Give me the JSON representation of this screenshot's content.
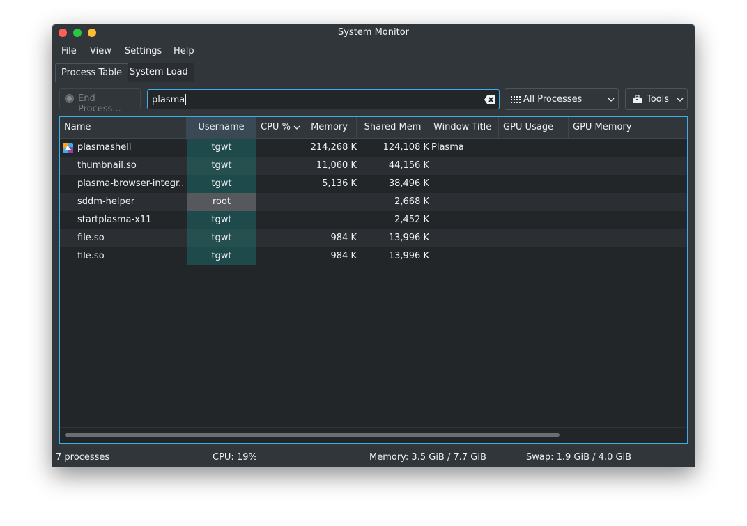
{
  "window": {
    "title": "System Monitor"
  },
  "menu": [
    "File",
    "View",
    "Settings",
    "Help"
  ],
  "tabs": [
    {
      "label": "Process Table",
      "active": true
    },
    {
      "label": "System Load",
      "active": false
    }
  ],
  "toolbar": {
    "end_process_label": "End Process...",
    "search_value": "plasma",
    "filter_selected": "All Processes",
    "tools_label": "Tools"
  },
  "columns": [
    "Name",
    "Username",
    "CPU %",
    "Memory",
    "Shared Mem",
    "Window Title",
    "GPU Usage",
    "GPU Memory"
  ],
  "rows": [
    {
      "name": "plasmashell",
      "user": "tgwt",
      "cpu": "",
      "memory": "214,268 K",
      "shared": "124,108 K",
      "window_title": "Plasma",
      "has_icon": true
    },
    {
      "name": "thumbnail.so",
      "user": "tgwt",
      "cpu": "",
      "memory": "11,060 K",
      "shared": "44,156 K",
      "window_title": ""
    },
    {
      "name": "plasma-browser-integr...",
      "user": "tgwt",
      "cpu": "",
      "memory": "5,136 K",
      "shared": "38,496 K",
      "window_title": ""
    },
    {
      "name": "sddm-helper",
      "user": "root",
      "cpu": "",
      "memory": "",
      "shared": "2,668 K",
      "window_title": ""
    },
    {
      "name": "startplasma-x11",
      "user": "tgwt",
      "cpu": "",
      "memory": "",
      "shared": "2,452 K",
      "window_title": ""
    },
    {
      "name": "file.so",
      "user": "tgwt",
      "cpu": "",
      "memory": "984 K",
      "shared": "13,996 K",
      "window_title": ""
    },
    {
      "name": "file.so",
      "user": "tgwt",
      "cpu": "",
      "memory": "984 K",
      "shared": "13,996 K",
      "window_title": ""
    }
  ],
  "status": {
    "processes": "7 processes",
    "cpu": "CPU: 19%",
    "memory": "Memory: 3.5 GiB / 7.7 GiB",
    "swap": "Swap: 1.9 GiB / 4.0 GiB"
  },
  "colors": {
    "window_bg": "#31363b",
    "view_bg": "#232629",
    "accent": "#3daee9",
    "user_highlight": "#1f4a4c",
    "root_highlight": "#55595d"
  }
}
